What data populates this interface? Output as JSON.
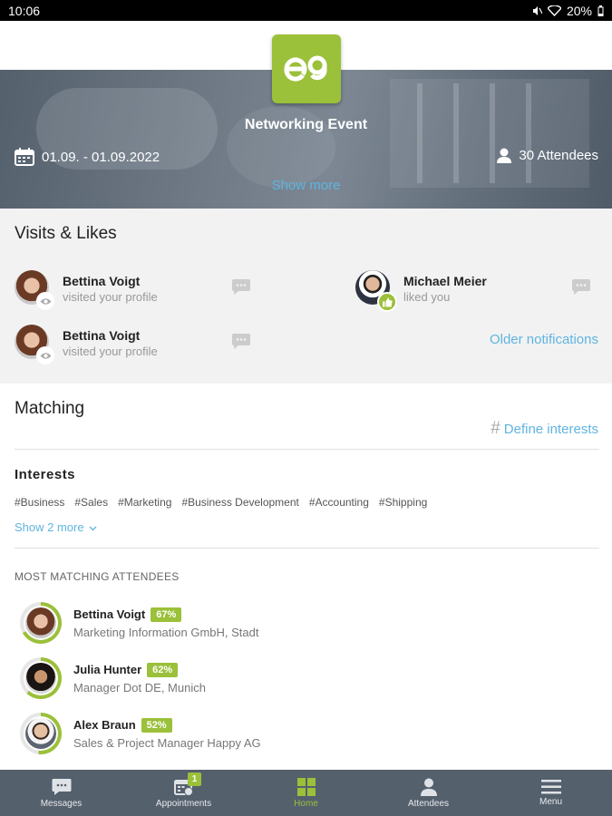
{
  "status_bar": {
    "time": "10:06",
    "battery": "20%",
    "icons": [
      "mute-icon",
      "wifi-icon",
      "battery-icon"
    ]
  },
  "event": {
    "logo_text": "e9",
    "title": "Networking Event",
    "date": "01.09. - 01.09.2022",
    "attendees": "30 Attendees",
    "show_more": "Show more"
  },
  "visits": {
    "title": "Visits & Likes",
    "items": [
      {
        "name": "Bettina Voigt",
        "action": "visited your profile",
        "badge": "eye-icon"
      },
      {
        "name": "Michael Meier",
        "action": "liked you",
        "badge": "thumbs-up-icon"
      },
      {
        "name": "Bettina Voigt",
        "action": "visited your profile",
        "badge": "eye-icon"
      }
    ],
    "older": "Older notifications"
  },
  "matching": {
    "title": "Matching",
    "define": "Define interests",
    "interests_title": "Interests",
    "tags": [
      "#Business",
      "#Sales",
      "#Marketing",
      "#Business Development",
      "#Accounting",
      "#Shipping"
    ],
    "show_more": "Show 2 more",
    "most_title": "MOST MATCHING ATTENDEES",
    "attendees": [
      {
        "name": "Bettina Voigt",
        "percent": "67%",
        "company": "Marketing Information GmbH, Stadt",
        "match": 0.67
      },
      {
        "name": "Julia Hunter",
        "percent": "62%",
        "company": "Manager Dot DE, Munich",
        "match": 0.62
      },
      {
        "name": "Alex Braun",
        "percent": "52%",
        "company": "Sales & Project Manager Happy AG",
        "match": 0.52
      }
    ]
  },
  "bottom_nav": [
    {
      "label": "Messages",
      "icon": "chat-icon",
      "active": false
    },
    {
      "label": "Appointments",
      "icon": "calendar-icon",
      "active": false,
      "badge": "1"
    },
    {
      "label": "Home",
      "icon": "grid-icon",
      "active": true
    },
    {
      "label": "Attendees",
      "icon": "person-icon",
      "active": false
    },
    {
      "label": "Menu",
      "icon": "hamburger-icon",
      "active": false
    }
  ],
  "colors": {
    "accent": "#9bc03a",
    "link": "#5fb4e0",
    "nav_bg": "#55606d"
  }
}
